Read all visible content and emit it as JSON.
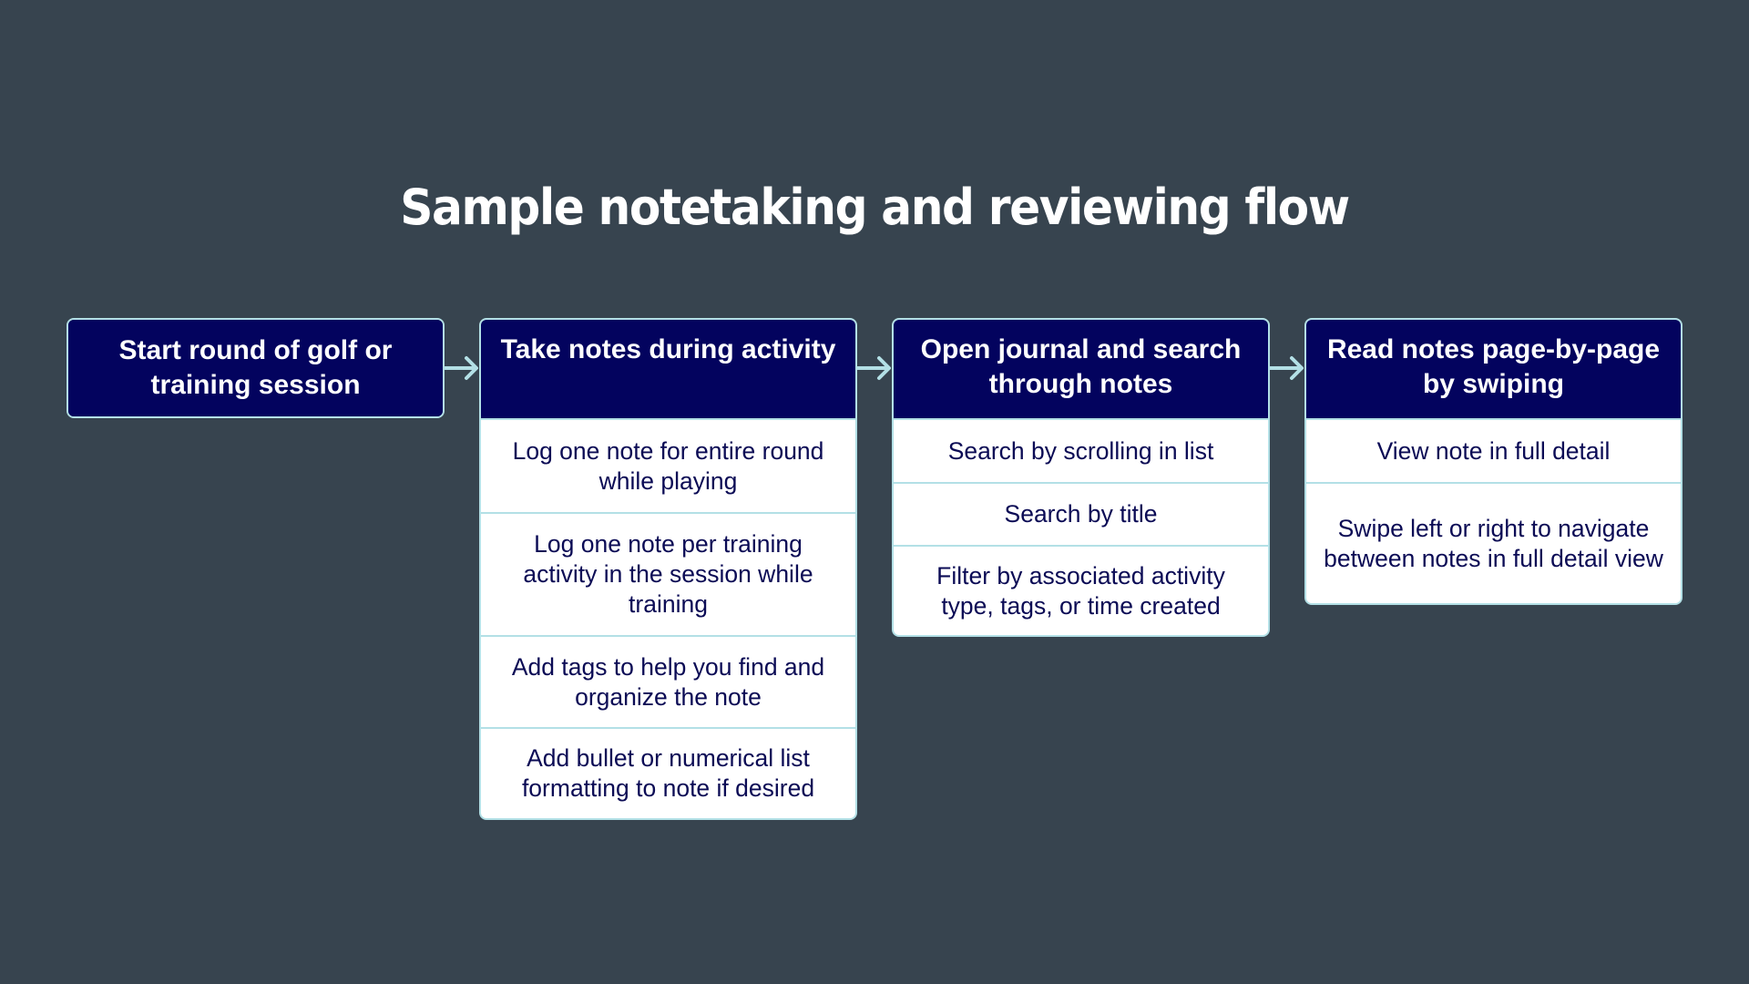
{
  "title": "Sample notetaking and reviewing flow",
  "colors": {
    "background": "#37444f",
    "header_fill": "#03035e",
    "border_accent": "#b3e0e6",
    "row_text": "#0b0b55",
    "row_fill": "#ffffff"
  },
  "columns": [
    {
      "header": "Start round of golf or training session",
      "items": []
    },
    {
      "header": "Take notes during activity",
      "items": [
        "Log one note for entire round while playing",
        "Log one note per training activity in the session while training",
        "Add tags to help you find and organize the note",
        "Add bullet or numerical list formatting to note if desired"
      ]
    },
    {
      "header": "Open journal and search through notes",
      "items": [
        "Search by scrolling in list",
        "Search by title",
        "Filter by associated activity type, tags, or time created"
      ]
    },
    {
      "header": "Read notes page-by-page by swiping",
      "items": [
        "View note in full detail",
        "Swipe left or right to navigate between notes in full detail view"
      ]
    }
  ],
  "connectors": [
    {
      "from": 0,
      "to": 1,
      "icon": "arrow-right-icon"
    },
    {
      "from": 1,
      "to": 2,
      "icon": "arrow-right-icon"
    },
    {
      "from": 2,
      "to": 3,
      "icon": "arrow-right-icon"
    }
  ]
}
